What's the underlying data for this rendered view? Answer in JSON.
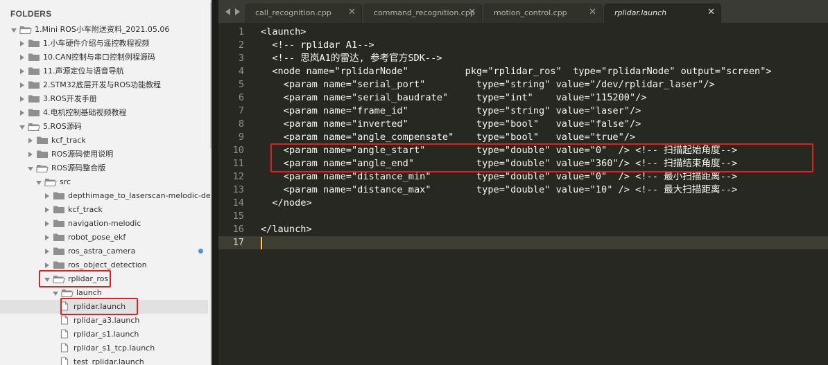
{
  "sidebar": {
    "title": "FOLDERS",
    "items": [
      {
        "label": "1.Mini ROS小车附送资料_2021.05.06",
        "depth": 0,
        "expanded": true,
        "kind": "folder"
      },
      {
        "label": "1.小车硬件介绍与遥控教程视频",
        "depth": 1,
        "expanded": false,
        "kind": "folder"
      },
      {
        "label": "10.CAN控制与串口控制例程源码",
        "depth": 1,
        "expanded": false,
        "kind": "folder"
      },
      {
        "label": "11.声源定位与语音导航",
        "depth": 1,
        "expanded": false,
        "kind": "folder"
      },
      {
        "label": "2.STM32底层开发与ROS功能教程",
        "depth": 1,
        "expanded": false,
        "kind": "folder"
      },
      {
        "label": "3.ROS开发手册",
        "depth": 1,
        "expanded": false,
        "kind": "folder"
      },
      {
        "label": "4.电机控制基础视频教程",
        "depth": 1,
        "expanded": false,
        "kind": "folder"
      },
      {
        "label": "5.ROS源码",
        "depth": 1,
        "expanded": true,
        "kind": "folder"
      },
      {
        "label": "kcf_track",
        "depth": 2,
        "expanded": false,
        "kind": "folder"
      },
      {
        "label": "ROS源码使用说明",
        "depth": 2,
        "expanded": false,
        "kind": "folder"
      },
      {
        "label": "ROS源码整合版",
        "depth": 2,
        "expanded": true,
        "kind": "folder"
      },
      {
        "label": "src",
        "depth": 3,
        "expanded": true,
        "kind": "folder"
      },
      {
        "label": "depthimage_to_laserscan-melodic-devel",
        "depth": 4,
        "expanded": false,
        "kind": "folder"
      },
      {
        "label": "kcf_track",
        "depth": 4,
        "expanded": false,
        "kind": "folder"
      },
      {
        "label": "navigation-melodic",
        "depth": 4,
        "expanded": false,
        "kind": "folder"
      },
      {
        "label": "robot_pose_ekf",
        "depth": 4,
        "expanded": false,
        "kind": "folder"
      },
      {
        "label": "ros_astra_camera",
        "depth": 4,
        "expanded": false,
        "kind": "folder",
        "dot": true
      },
      {
        "label": "ros_object_detection",
        "depth": 4,
        "expanded": false,
        "kind": "folder"
      },
      {
        "label": "rplidar_ros",
        "depth": 4,
        "expanded": true,
        "kind": "folder"
      },
      {
        "label": "launch",
        "depth": 5,
        "expanded": true,
        "kind": "folder"
      },
      {
        "label": "rplidar.launch",
        "depth": 6,
        "kind": "file",
        "selected": true
      },
      {
        "label": "rplidar_a3.launch",
        "depth": 6,
        "kind": "file"
      },
      {
        "label": "rplidar_s1.launch",
        "depth": 6,
        "kind": "file"
      },
      {
        "label": "rplidar_s1_tcp.launch",
        "depth": 6,
        "kind": "file"
      },
      {
        "label": "test_rplidar.launch",
        "depth": 6,
        "kind": "file"
      }
    ]
  },
  "tabs": [
    {
      "label": "call_recognition.cpp",
      "active": false
    },
    {
      "label": "command_recognition.cpp",
      "active": false
    },
    {
      "label": "motion_control.cpp",
      "active": false
    },
    {
      "label": "rplidar.launch",
      "active": true
    }
  ],
  "tab_close_glyph": "✕",
  "code_lines": [
    {
      "n": "1",
      "text": "<launch>"
    },
    {
      "n": "2",
      "text": "  <!-- rplidar A1-->"
    },
    {
      "n": "3",
      "text": "  <!-- 思岚A1的雷达, 参考官方SDK-->"
    },
    {
      "n": "4",
      "text": "  <node name=\"rplidarNode\"          pkg=\"rplidar_ros\"  type=\"rplidarNode\" output=\"screen\">"
    },
    {
      "n": "5",
      "text": "    <param name=\"serial_port\"         type=\"string\" value=\"/dev/rplidar_laser\"/>"
    },
    {
      "n": "6",
      "text": "    <param name=\"serial_baudrate\"     type=\"int\"    value=\"115200\"/>"
    },
    {
      "n": "7",
      "text": "    <param name=\"frame_id\"            type=\"string\" value=\"laser\"/>"
    },
    {
      "n": "8",
      "text": "    <param name=\"inverted\"            type=\"bool\"   value=\"false\"/>"
    },
    {
      "n": "9",
      "text": "    <param name=\"angle_compensate\"    type=\"bool\"   value=\"true\"/>"
    },
    {
      "n": "10",
      "text": "    <param name=\"angle_start\"         type=\"double\" value=\"0\"  /> <!-- 扫描起始角度-->"
    },
    {
      "n": "11",
      "text": "    <param name=\"angle_end\"           type=\"double\" value=\"360\"/> <!-- 扫描结束角度-->"
    },
    {
      "n": "12",
      "text": "    <param name=\"distance_min\"        type=\"double\" value=\"0\"  /> <!-- 最小扫描距离-->"
    },
    {
      "n": "13",
      "text": "    <param name=\"distance_max\"        type=\"double\" value=\"10\" /> <!-- 最大扫描距离-->"
    },
    {
      "n": "14",
      "text": "  </node>"
    },
    {
      "n": "15",
      "text": ""
    },
    {
      "n": "16",
      "text": "</launch>"
    },
    {
      "n": "17",
      "text": ""
    }
  ],
  "current_line": 17,
  "colors": {
    "editor_bg": "#272822",
    "sidebar_bg": "#f2f2f2",
    "highlight_red": "#e02020",
    "modified_dot": "#4a90d9"
  }
}
